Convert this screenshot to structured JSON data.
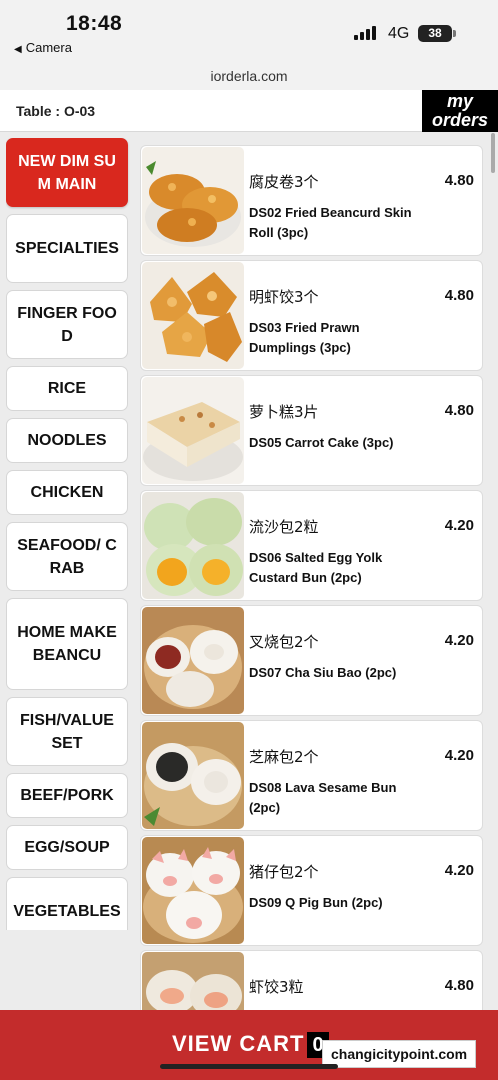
{
  "status": {
    "time": "18:48",
    "back_app": "Camera",
    "network": "4G",
    "battery": "38"
  },
  "browser": {
    "url": "iorderla.com"
  },
  "header": {
    "table": "Table : O-03",
    "my_orders": "my orders"
  },
  "categories": [
    {
      "label": "NEW DIM SUM MAIN",
      "active": true
    },
    {
      "label": "SPECIALTIES"
    },
    {
      "label": "FINGER FOOD"
    },
    {
      "label": "RICE"
    },
    {
      "label": "NOODLES"
    },
    {
      "label": "CHICKEN"
    },
    {
      "label": "SEAFOOD/ CRAB"
    },
    {
      "label": "HOME MAKE BEANCU"
    },
    {
      "label": "FISH/VALUE SET"
    },
    {
      "label": "BEEF/PORK"
    },
    {
      "label": "EGG/SOUP"
    },
    {
      "label": "VEGETABLES"
    }
  ],
  "items": [
    {
      "zh": "腐皮卷3个",
      "en": "DS02 Fried Beancurd Skin Roll (3pc)",
      "price": "4.80"
    },
    {
      "zh": "明虾饺3个",
      "en": "DS03 Fried Prawn Dumplings (3pc)",
      "price": "4.80"
    },
    {
      "zh": "萝卜糕3片",
      "en": "DS05 Carrot Cake (3pc)",
      "price": "4.80"
    },
    {
      "zh": "流沙包2粒",
      "en": "DS06 Salted Egg Yolk Custard Bun (2pc)",
      "price": "4.20"
    },
    {
      "zh": "叉烧包2个",
      "en": "DS07 Cha Siu Bao (2pc)",
      "price": "4.20"
    },
    {
      "zh": "芝麻包2个",
      "en": "DS08 Lava Sesame Bun (2pc)",
      "price": "4.20"
    },
    {
      "zh": "猪仔包2个",
      "en": "DS09 Q Pig Bun (2pc)",
      "price": "4.20"
    },
    {
      "zh": "虾饺3粒",
      "en": "",
      "price": "4.80"
    }
  ],
  "cart": {
    "label": "VIEW CART",
    "count": "0"
  },
  "watermark": "changicitypoint.com",
  "colors": {
    "accent": "#d9281e",
    "cart_bar": "#c32c2c"
  }
}
